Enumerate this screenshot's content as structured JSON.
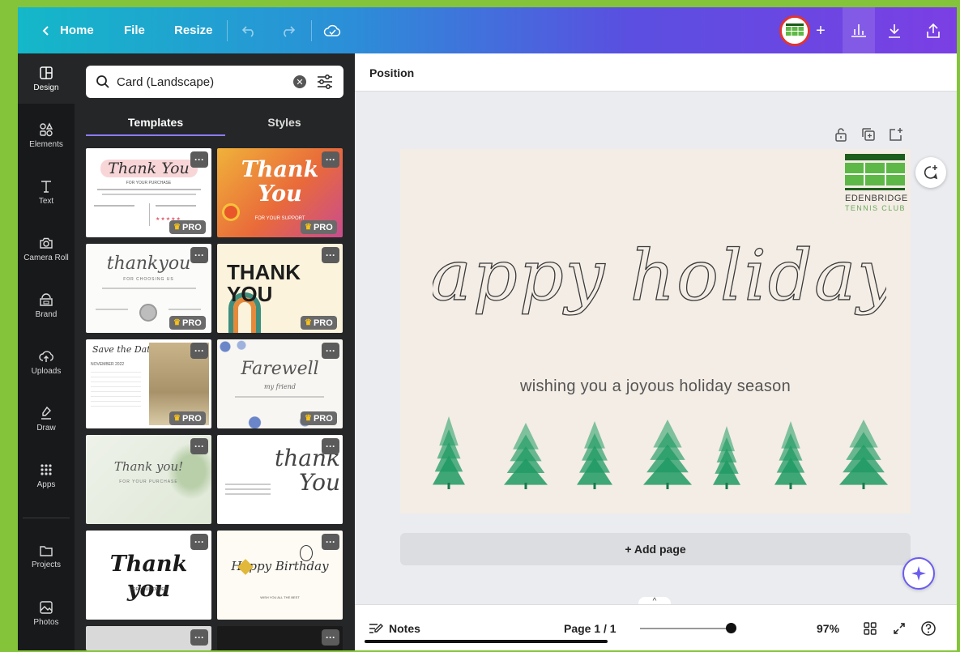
{
  "topbar": {
    "home_label": "Home",
    "file_label": "File",
    "resize_label": "Resize"
  },
  "rail": [
    {
      "label": "Design",
      "icon": "layout-icon"
    },
    {
      "label": "Elements",
      "icon": "shapes-icon"
    },
    {
      "label": "Text",
      "icon": "text-icon"
    },
    {
      "label": "Camera Roll",
      "icon": "camera-icon"
    },
    {
      "label": "Brand",
      "icon": "brand-icon"
    },
    {
      "label": "Uploads",
      "icon": "upload-cloud-icon"
    },
    {
      "label": "Draw",
      "icon": "draw-icon"
    },
    {
      "label": "Apps",
      "icon": "apps-grid-icon"
    },
    {
      "label": "Projects",
      "icon": "folder-icon"
    },
    {
      "label": "Photos",
      "icon": "photo-icon"
    }
  ],
  "panel": {
    "search_value": "Card (Landscape)",
    "tabs": [
      "Templates",
      "Styles"
    ],
    "pro_label": "PRO",
    "templates": [
      {
        "text": "Thank You",
        "sub": "FOR YOUR PURCHASE",
        "pro": true
      },
      {
        "text": "Thank You",
        "sub": "FOR YOUR SUPPORT",
        "pro": true
      },
      {
        "text": "thankyou",
        "sub": "FOR CHOOSING US",
        "pro": true
      },
      {
        "text": "THANK YOU",
        "sub": "",
        "pro": true
      },
      {
        "text": "Save the Date",
        "sub": "NOVEMBER 2022",
        "pro": true
      },
      {
        "text": "Farewell",
        "sub": "my friend",
        "pro": true
      },
      {
        "text": "Thank you!",
        "sub": "FOR YOUR PURCHASE",
        "pro": false
      },
      {
        "text": "thank You",
        "sub": "",
        "pro": false
      },
      {
        "text": "Thank you",
        "sub": "FOR YOUR ORDER",
        "pro": false
      },
      {
        "text": "Happy Birthday",
        "sub": "WISH YOU ALL THE BEST",
        "pro": false
      }
    ]
  },
  "context_bar": {
    "position_label": "Position"
  },
  "card": {
    "headline": "happy holidays",
    "message": "wishing you a joyous holiday season",
    "logo_name": "EDENBRIDGE",
    "logo_sub": "TENNIS CLUB",
    "tree_color": "#1f9a63"
  },
  "add_page_label": "+ Add page",
  "bottombar": {
    "notes_label": "Notes",
    "page_indicator": "Page 1 / 1",
    "zoom_value": "97%",
    "zoom_fraction": 0.97
  },
  "colors": {
    "accent": "#8b7cf6",
    "panel_bg": "#252627",
    "rail_bg": "#18191b",
    "card_bg": "#f3ede5"
  }
}
